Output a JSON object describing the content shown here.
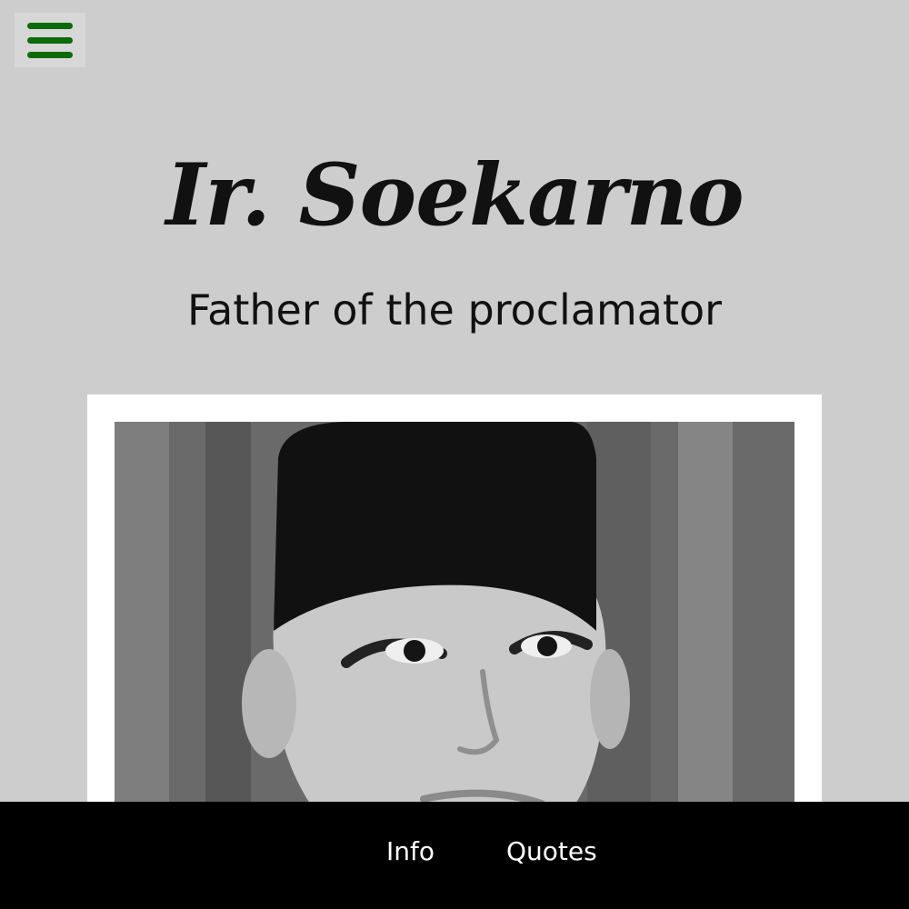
{
  "header": {
    "menu_icon": "hamburger-menu-icon",
    "accent_color": "#0a6b0a"
  },
  "hero": {
    "title": "Ir. Soekarno",
    "subtitle": "Father of the proclamator"
  },
  "portrait": {
    "subject": "Black-and-white portrait photo of Soekarno wearing a peci"
  },
  "nav": {
    "items": [
      {
        "label": "Info"
      },
      {
        "label": "Quotes"
      }
    ]
  }
}
